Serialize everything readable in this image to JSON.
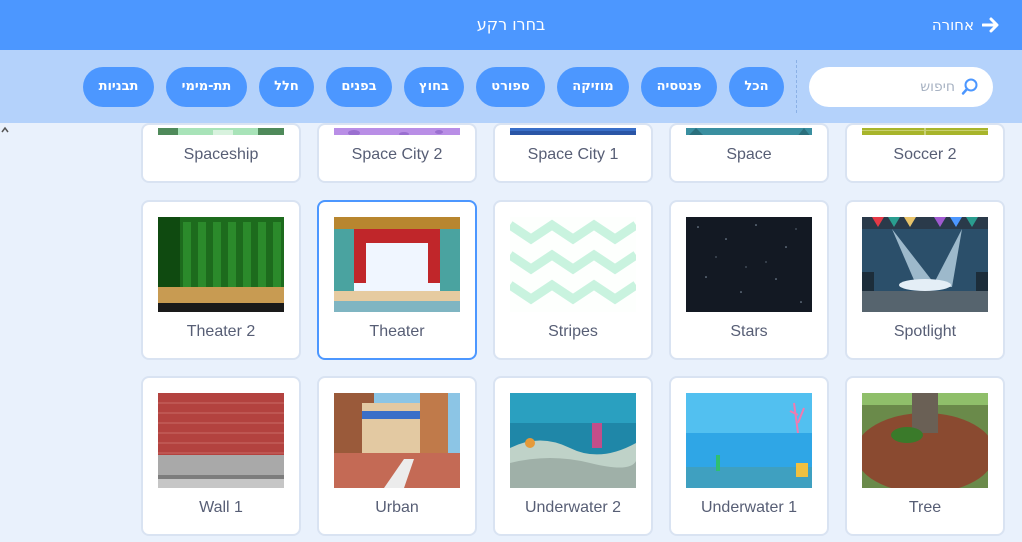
{
  "header": {
    "title": "בחרו רקע",
    "back_label": "אחורה"
  },
  "search": {
    "placeholder": "חיפוש"
  },
  "tags": [
    {
      "label": "הכל",
      "active": true
    },
    {
      "label": "פנטסיה",
      "active": false
    },
    {
      "label": "מוזיקה",
      "active": false
    },
    {
      "label": "ספורט",
      "active": false
    },
    {
      "label": "בחוץ",
      "active": false
    },
    {
      "label": "בפנים",
      "active": false
    },
    {
      "label": "חלל",
      "active": false
    },
    {
      "label": "תת-מימי",
      "active": false
    },
    {
      "label": "תבניות",
      "active": false
    }
  ],
  "backdrops": {
    "row0": [
      "Spaceship",
      "Space City 2",
      "Space City 1",
      "Space",
      "Soccer 2"
    ],
    "row1": [
      "Theater 2",
      "Theater",
      "Stripes",
      "Stars",
      "Spotlight"
    ],
    "row2": [
      "Wall 1",
      "Urban",
      "Underwater 2",
      "Underwater 1",
      "Tree"
    ]
  },
  "selected": "Theater",
  "colors": {
    "accent": "#4c97ff",
    "active_tag": "#ff8c1a",
    "filter_bar": "#b4d2fb",
    "label": "#575e75"
  }
}
